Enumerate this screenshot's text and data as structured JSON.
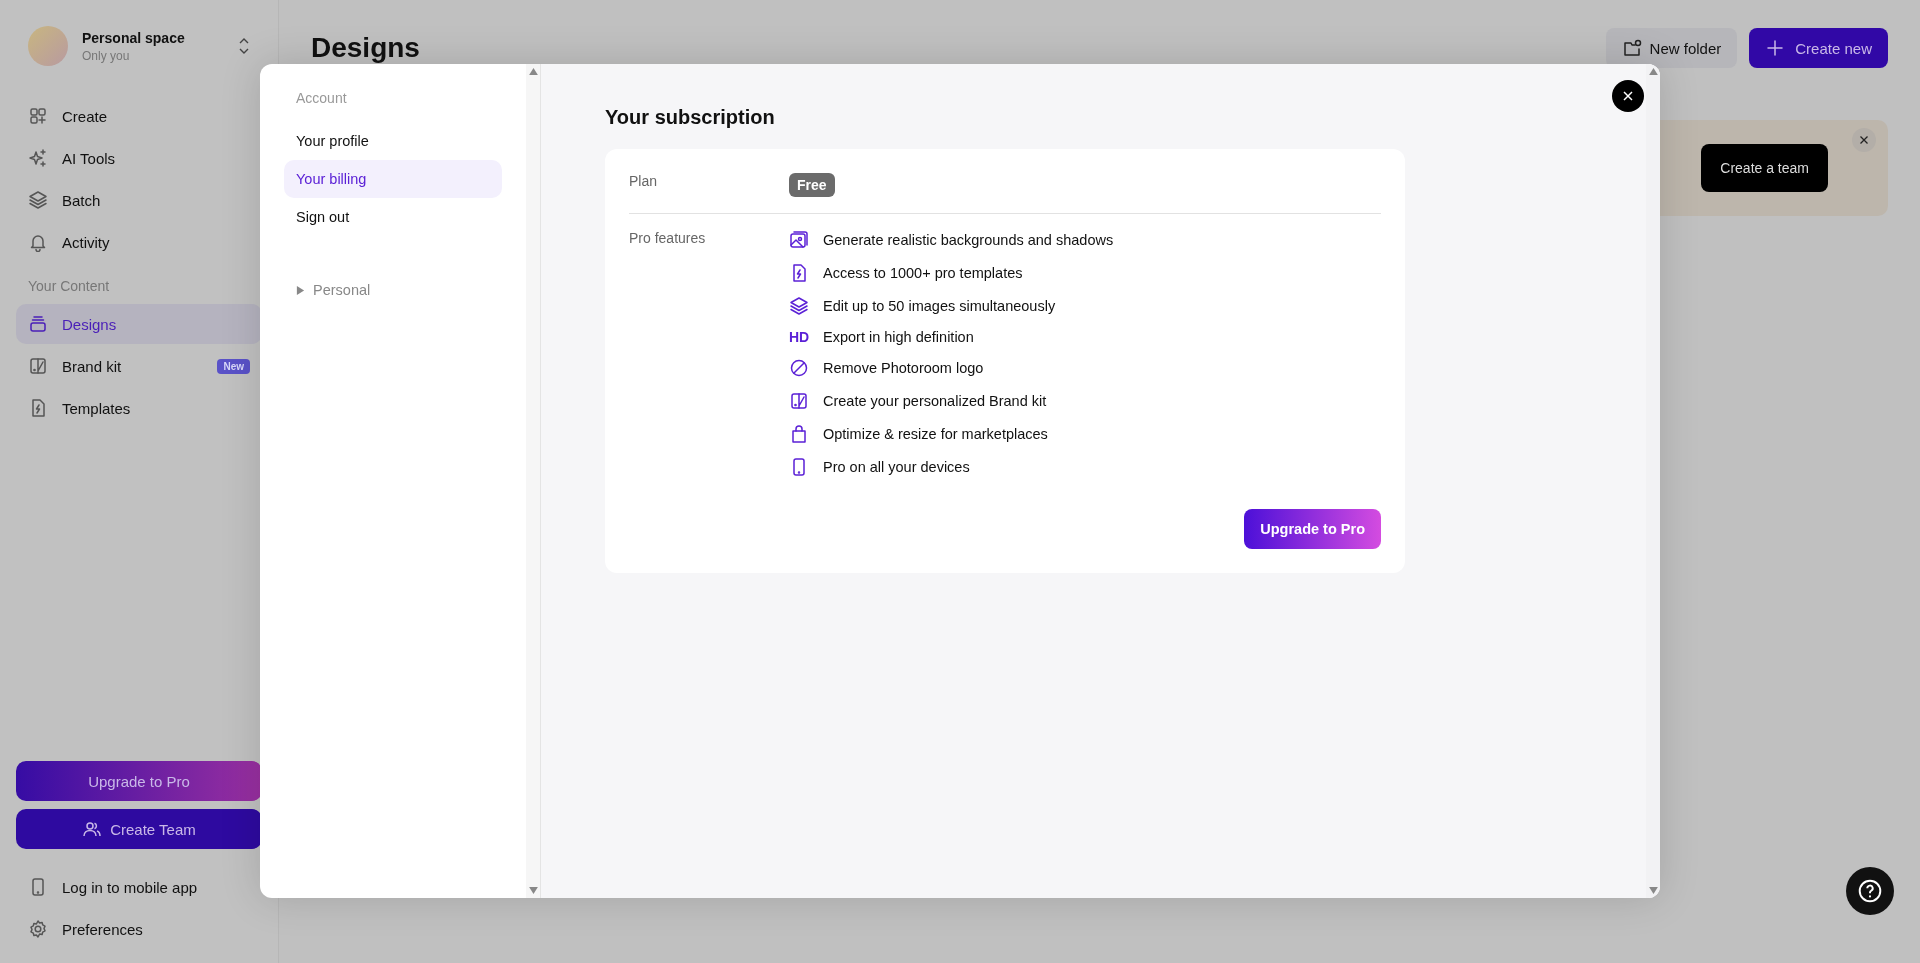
{
  "sidebar": {
    "workspace": {
      "name": "Personal space",
      "subtitle": "Only you"
    },
    "nav": [
      {
        "label": "Create"
      },
      {
        "label": "AI Tools"
      },
      {
        "label": "Batch"
      },
      {
        "label": "Activity"
      }
    ],
    "section_label": "Your Content",
    "content_items": [
      {
        "label": "Designs",
        "selected": true
      },
      {
        "label": "Brand kit",
        "selected": false,
        "badge": "New"
      },
      {
        "label": "Templates",
        "selected": false
      }
    ],
    "upgrade_button": "Upgrade to Pro",
    "create_team_button": "Create Team",
    "footer_items": [
      {
        "label": "Log in to mobile app"
      },
      {
        "label": "Preferences"
      }
    ]
  },
  "main": {
    "title": "Designs",
    "new_folder_button": "New folder",
    "create_new_button": "Create new",
    "banner_button": "Create a team"
  },
  "modal": {
    "nav": {
      "section_label": "Account",
      "items": [
        {
          "label": "Your profile",
          "selected": false
        },
        {
          "label": "Your billing",
          "selected": true
        },
        {
          "label": "Sign out",
          "selected": false
        }
      ],
      "group": {
        "label": "Personal",
        "expanded": false
      }
    },
    "subscription": {
      "title": "Your subscription",
      "plan_label": "Plan",
      "plan_value": "Free",
      "features_label": "Pro features",
      "features": [
        {
          "text": "Generate realistic backgrounds and shadows"
        },
        {
          "text": "Access to 1000+ pro templates"
        },
        {
          "text": "Edit up to 50 images simultaneously"
        },
        {
          "text": "Export in high definition",
          "icon_text": "HD"
        },
        {
          "text": "Remove Photoroom logo"
        },
        {
          "text": "Create your personalized Brand kit"
        },
        {
          "text": "Optimize & resize for marketplaces"
        },
        {
          "text": "Pro on all your devices"
        }
      ],
      "upgrade_button": "Upgrade to Pro"
    }
  }
}
